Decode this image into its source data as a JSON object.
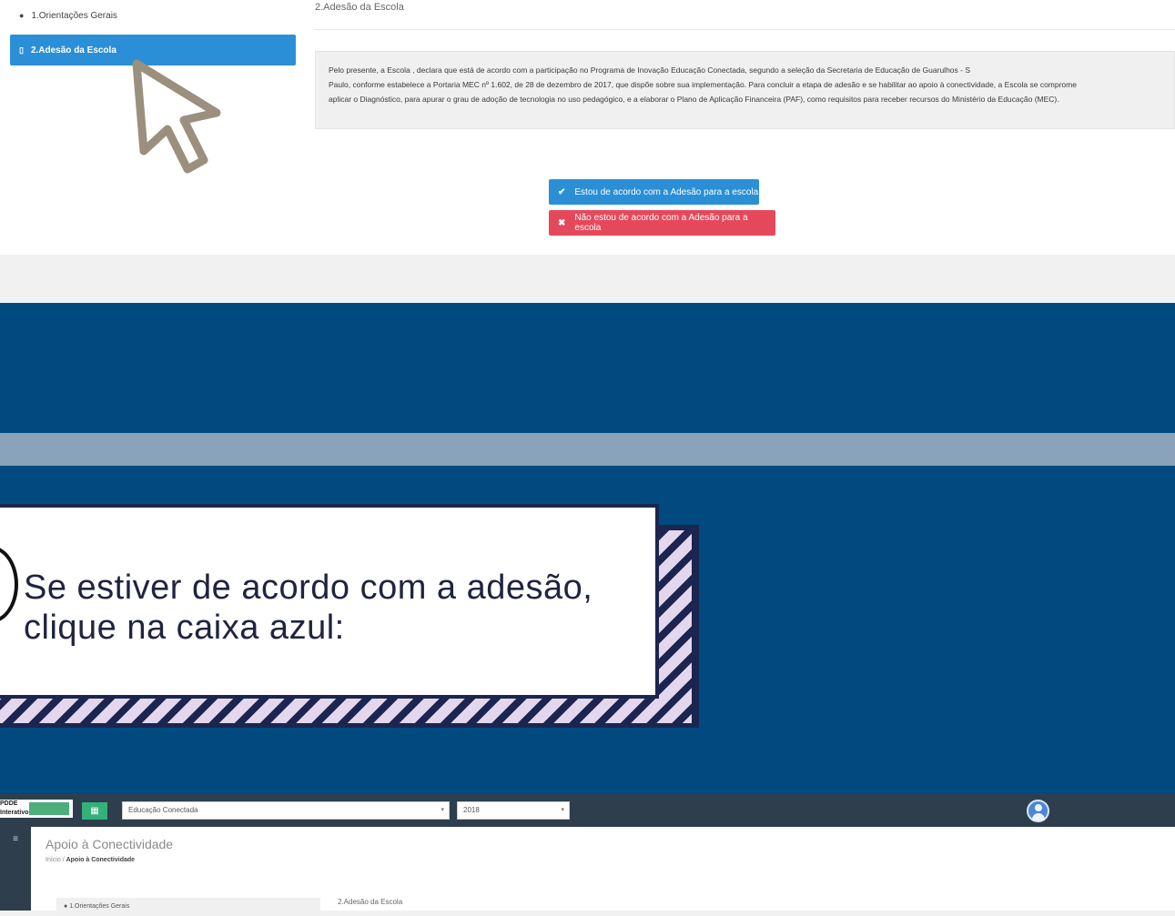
{
  "top_screen": {
    "sidebar": {
      "items": [
        {
          "label": "1.Orientações Gerais",
          "icon": "info-circle-icon",
          "active": false
        },
        {
          "label": "2.Adesão da Escola",
          "icon": "document-icon",
          "active": true
        }
      ]
    },
    "section_title": "2.Adesão da Escola",
    "adhesion_text_lines": [
      "Pelo presente, a Escola                                                   , declara que está de acordo com a participação no Programa de Inovação Educação Conectada, segundo a seleção da Secretaria de Educação de Guarulhos - S",
      "Paulo, conforme estabelece a Portaria MEC nº 1.602, de 28 de dezembro de 2017, que dispõe sobre sua implementação. Para concluir a etapa de adesão e se habilitar ao apoio à conectividade, a Escola se comprome",
      "aplicar o Diagnóstico, para apurar o grau de adoção de tecnologia no uso pedagógico, e a elaborar o Plano de Aplicação Financeira (PAF), como requisitos para receber recursos do Ministério da Educação (MEC)."
    ],
    "buttons": {
      "agree_label": "Estou de acordo com a Adesão para a escola",
      "agree_icon": "check-icon",
      "disagree_label": "Não estou de acordo com a Adesão para a escola",
      "disagree_icon": "x-icon"
    },
    "colors": {
      "primary": "#2a8fd6",
      "danger": "#e5485b"
    }
  },
  "callout": {
    "text_line1": "Se estiver de acordo com a adesão,",
    "text_line2": "clique na caixa azul:",
    "colors": {
      "band": "#004a80",
      "stripe": "#8aa3bb",
      "card_border": "#1c2550",
      "card_stripes": "#e3d7ee"
    }
  },
  "bottom_screen": {
    "logo_text": "PDDE",
    "logo_sub": "Interativo",
    "menu_icon": "grid-icon",
    "program_select": "Educação Conectada",
    "year_select": "2018",
    "page_title": "Apoio à Conectividade",
    "breadcrumb": {
      "home": "Início",
      "separator": "/",
      "current": "Apoio à Conectividade"
    },
    "sidebar_first_item": "1.Orientações Gerais",
    "section_title": "2.Adesão da Escola",
    "colors": {
      "topbar": "#2e3e4c",
      "menu_button": "#34b07a"
    }
  }
}
